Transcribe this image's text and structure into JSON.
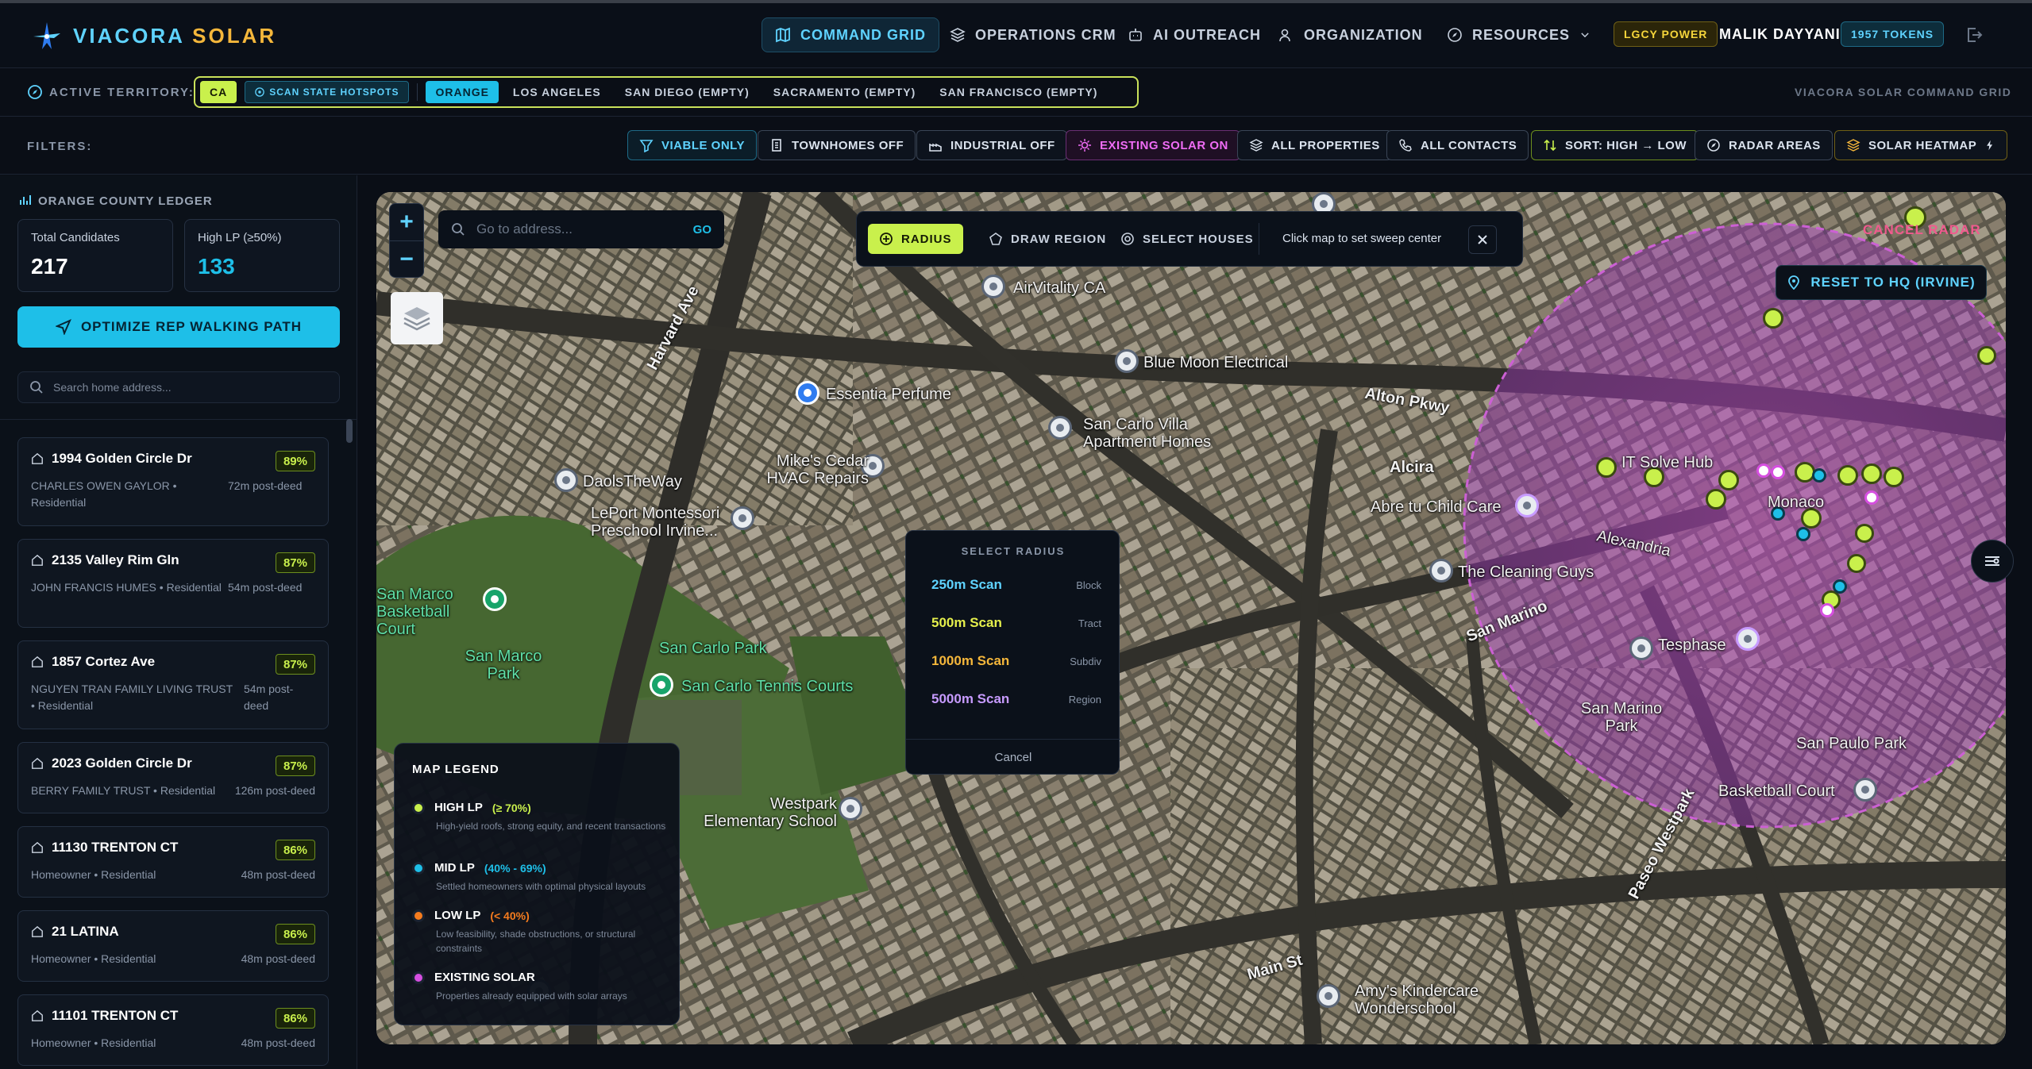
{
  "brand": {
    "name_a": "VIACORA",
    "name_b": "SOLAR"
  },
  "nav": {
    "items": [
      "COMMAND GRID",
      "OPERATIONS CRM",
      "AI OUTREACH",
      "ORGANIZATION",
      "RESOURCES"
    ],
    "org_badge": "LGCY POWER",
    "user": "MALIK DAYYANI",
    "tokens": "1957 TOKENS"
  },
  "territory": {
    "label": "ACTIVE TERRITORY:",
    "state": "CA",
    "scan_label": "SCAN STATE HOTSPOTS",
    "counties": [
      "ORANGE",
      "LOS ANGELES",
      "SAN DIEGO (EMPTY)",
      "SACRAMENTO (EMPTY)",
      "SAN FRANCISCO (EMPTY)"
    ],
    "right_caption": "VIACORA SOLAR COMMAND GRID"
  },
  "filters": {
    "label": "FILTERS:",
    "buttons": [
      "VIABLE ONLY",
      "TOWNHOMES OFF",
      "INDUSTRIAL OFF",
      "EXISTING SOLAR ON",
      "ALL PROPERTIES",
      "ALL CONTACTS",
      "SORT: HIGH → LOW",
      "RADAR AREAS",
      "SOLAR HEATMAP"
    ]
  },
  "ledger": {
    "title": "ORANGE COUNTY LEDGER",
    "total_label": "Total Candidates",
    "total_value": "217",
    "high_label": "High LP (≥50%)",
    "high_value": "133",
    "optimize_label": "OPTIMIZE REP WALKING PATH",
    "search_placeholder": "Search home address...",
    "cards": [
      {
        "address": "1994 Golden Circle Dr",
        "pct": "89%",
        "owner": "CHARLES OWEN GAYLOR • Residential",
        "deed": "72m post-deed"
      },
      {
        "address": "2135 Valley Rim Gln",
        "pct": "87%",
        "owner": "JOHN FRANCIS HUMES • Residential",
        "deed": "54m post-deed"
      },
      {
        "address": "1857 Cortez Ave",
        "pct": "87%",
        "owner": "NGUYEN TRAN FAMILY LIVING TRUST • Residential",
        "deed": "54m post-deed"
      },
      {
        "address": "2023 Golden Circle Dr",
        "pct": "87%",
        "owner": "BERRY FAMILY TRUST • Residential",
        "deed": "126m post-deed"
      },
      {
        "address": "11130 TRENTON CT",
        "pct": "86%",
        "owner": "Homeowner • Residential",
        "deed": "48m post-deed"
      },
      {
        "address": "21 LATINA",
        "pct": "86%",
        "owner": "Homeowner • Residential",
        "deed": "48m post-deed"
      },
      {
        "address": "11101 TRENTON CT",
        "pct": "86%",
        "owner": "Homeowner • Residential",
        "deed": "48m post-deed"
      }
    ]
  },
  "map": {
    "search_placeholder": "Go to address...",
    "search_go": "GO",
    "modes": [
      "RADIUS",
      "DRAW REGION",
      "SELECT HOUSES"
    ],
    "hint": "Click map to set sweep center",
    "cancel_radar": "CANCEL RADAR",
    "hq_button": "RESET TO HQ (IRVINE)",
    "radius_popup": {
      "title": "SELECT RADIUS",
      "options": [
        {
          "name": "250m Scan",
          "scope": "Block",
          "color": "#5fd3ff"
        },
        {
          "name": "500m Scan",
          "scope": "Tract",
          "color": "#e6f04c"
        },
        {
          "name": "1000m Scan",
          "scope": "Subdiv",
          "color": "#f5b73b"
        },
        {
          "name": "5000m Scan",
          "scope": "Region",
          "color": "#c79bff"
        }
      ],
      "cancel": "Cancel"
    },
    "legend": {
      "title": "MAP LEGEND",
      "items": [
        {
          "name": "HIGH LP",
          "range": "(≥ 70%)",
          "desc": "High-yield roofs, strong equity, and recent transactions",
          "color": "#c9f04c"
        },
        {
          "name": "MID LP",
          "range": "(40% - 69%)",
          "desc": "Settled homeowners with optimal physical layouts",
          "color": "#1ebfe8"
        },
        {
          "name": "LOW LP",
          "range": "(< 40%)",
          "desc": "Low feasibility, shade obstructions, or structural constraints",
          "color": "#f57c1e"
        },
        {
          "name": "EXISTING SOLAR",
          "range": "",
          "desc": "Properties already equipped with solar arrays",
          "color": "#d64fe0"
        }
      ]
    },
    "places": [
      "AirVitality CA",
      "Blue Moon Electrical",
      "Essentia Perfume",
      "Alton Pkwy",
      "San Carlo Villa Apartment Homes",
      "Mike's Cedar HVAC Repairs",
      "DaolsTheWay",
      "LePort Montessori Preschool Irvine...",
      "Alcira",
      "Abre tu Child Care",
      "The Cleaning Guys",
      "San Marco Basketball Court",
      "San Marco Park",
      "San Carlo Park",
      "San Carlo Tennis Courts",
      "Westpark Elementary School",
      "IT Solve Hub",
      "Tesphase",
      "Monaco",
      "Alexandria",
      "San Marino Park",
      "San Paulo Park",
      "Basketball Court",
      "Amy's Kindercare Wonderschool",
      "Harvard Ave",
      "Main St",
      "San Marino",
      "Paseo Westpark"
    ]
  },
  "colors": {
    "accent": "#1ebfe8",
    "lime": "#c9f04c",
    "solar": "#d64fe0",
    "gold": "#f5b73b"
  }
}
